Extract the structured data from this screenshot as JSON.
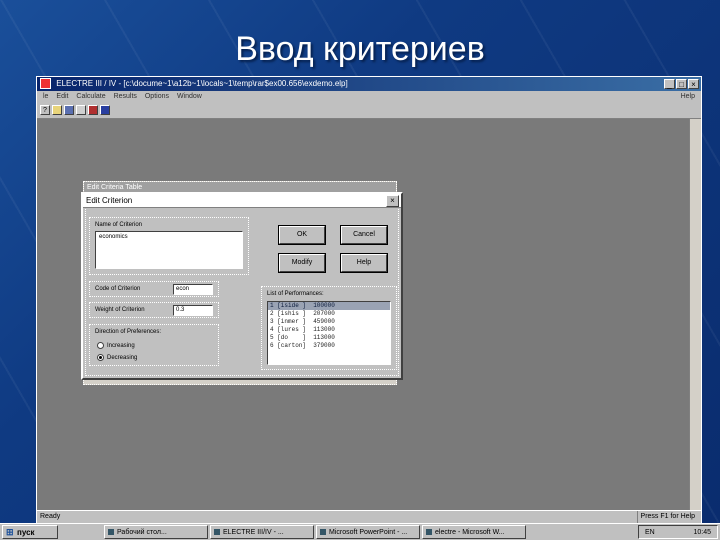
{
  "slide": {
    "title": "Ввод критериев"
  },
  "app": {
    "title": "ELECTRE III / IV - [c:\\docume~1\\a12b~1\\locals~1\\temp\\rar$ex00.656\\exdemo.elp]",
    "menu": [
      "le",
      "Edit",
      "Calculate",
      "Results",
      "Options",
      "Window"
    ],
    "menu_help": "Help",
    "toolbar_icons": [
      "help-icon",
      "open-icon",
      "save-icon",
      "print-icon",
      "table-icon",
      "stop-icon"
    ],
    "status_left": "Ready",
    "status_right": "Press F1 for Help"
  },
  "back_dialog": {
    "title": "Edit Criteria Table"
  },
  "dialog": {
    "title": "Edit Criterion",
    "name_label": "Name of Criterion",
    "name_value": "economics",
    "code_label": "Code of Criterion",
    "code_value": "econ",
    "weight_label": "Weight of Criterion",
    "weight_value": "0.3",
    "direction_label": "Direction of Preferences:",
    "direction_options": [
      {
        "label": "Increasing",
        "selected": false
      },
      {
        "label": "Decreasing",
        "selected": true
      }
    ],
    "buttons": {
      "ok": "OK",
      "cancel": "Cancel",
      "modify": "Modify",
      "help": "Help"
    },
    "performances_label": "List of Performances:",
    "performances": [
      "1 [iside ]  100000",
      "2 [ishis ]  207000",
      "3 [inmer ]  459000",
      "4 [lures ]  113000",
      "5 [do    ]  113000",
      "6 [carton]  379000"
    ]
  },
  "taskbar": {
    "start": "пуск",
    "tasks": [
      "Рабочий стол...",
      "ELECTRE III/IV - ...",
      "Microsoft PowerPoint - ...",
      "electre - Microsoft W..."
    ],
    "lang": "EN",
    "clock": "10:45"
  }
}
